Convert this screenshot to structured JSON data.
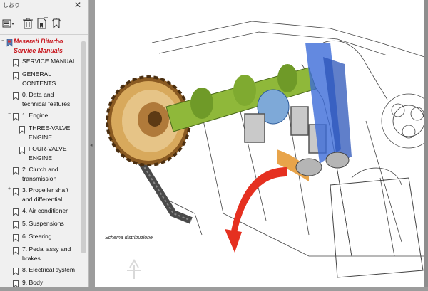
{
  "sidebar": {
    "title": "しおり",
    "close_glyph": "✕",
    "toolbar": {
      "options_icon": "list-options-icon",
      "delete_icon": "trash-icon",
      "new_bookmark_icon": "new-bookmark-icon",
      "find_bookmark_icon": "find-bookmark-icon"
    },
    "items": [
      {
        "label": "Maserati Biturbo Service Manuals",
        "root": true,
        "toggle": "−"
      },
      {
        "label": "SERVICE MANUAL"
      },
      {
        "label": "GENERAL CONTENTS"
      },
      {
        "label": "0. Data and technical features"
      },
      {
        "label": "1. Engine",
        "toggle": "−"
      },
      {
        "label": "THREE-VALVE ENGINE"
      },
      {
        "label": "FOUR-VALVE ENGINE"
      },
      {
        "label": "2. Clutch and transmission"
      },
      {
        "label": "3. Propeller shaft and differential",
        "toggle": "+"
      },
      {
        "label": "4. Air conditioner"
      },
      {
        "label": "5. Suspensions"
      },
      {
        "label": "6. Steering"
      },
      {
        "label": "7. Pedal assy and brakes"
      },
      {
        "label": "8. Electrical system"
      },
      {
        "label": "9. Body"
      }
    ]
  },
  "document": {
    "caption": "Schema distribuzione"
  },
  "colors": {
    "root_label": "#c8161d",
    "sidebar_bg": "#f0f0f0",
    "viewer_bg": "#9c9c9c"
  }
}
